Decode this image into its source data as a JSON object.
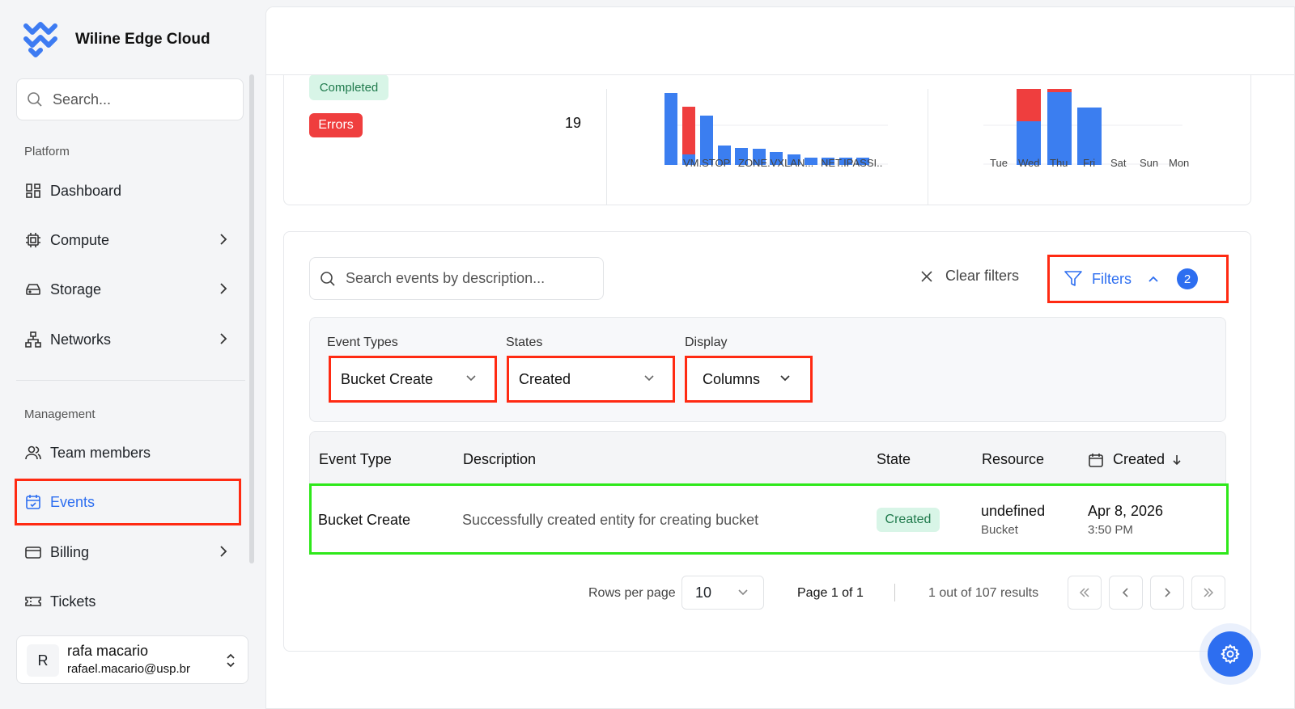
{
  "brand": {
    "name": "Wiline Edge Cloud"
  },
  "sidebar": {
    "search_placeholder": "Search...",
    "platform_label": "Platform",
    "platform_items": [
      {
        "label": "Dashboard",
        "icon": "dashboard-icon"
      },
      {
        "label": "Compute",
        "icon": "cpu-icon"
      },
      {
        "label": "Storage",
        "icon": "storage-icon"
      },
      {
        "label": "Networks",
        "icon": "network-icon"
      }
    ],
    "management_label": "Management",
    "management_items": [
      {
        "label": "Team members",
        "icon": "users-icon"
      },
      {
        "label": "Events",
        "icon": "calendar-check-icon",
        "active": true
      },
      {
        "label": "Billing",
        "icon": "credit-card-icon"
      },
      {
        "label": "Tickets",
        "icon": "ticket-icon"
      }
    ],
    "user": {
      "initial": "R",
      "name": "rafa macario",
      "email": "rafael.macario@usp.br"
    }
  },
  "stats": {
    "completed_label": "Completed",
    "errors_label": "Errors",
    "errors_count": "19",
    "event_type_chart": {
      "tick_labels": [
        "VM.STOP",
        "ZONE.VXLAN...",
        "NET.IPASSI.."
      ]
    },
    "weekday_chart": {
      "categories": [
        "Tue",
        "Wed",
        "Thu",
        "Fri",
        "Sat",
        "Sun",
        "Mon"
      ]
    }
  },
  "events": {
    "search_placeholder": "Search events by description...",
    "clear_filters_label": "Clear filters",
    "filters_label": "Filters",
    "filters_count": "2",
    "filter_panel": {
      "event_types_label": "Event Types",
      "event_types_value": "Bucket Create",
      "states_label": "States",
      "states_value": "Created",
      "display_label": "Display",
      "display_value": "Columns"
    },
    "columns": [
      "Event Type",
      "Description",
      "State",
      "Resource",
      "Created"
    ],
    "rows": [
      {
        "event_type": "Bucket Create",
        "description": "Successfully created entity for creating bucket",
        "state": "Created",
        "resource": "undefined",
        "resource_type": "Bucket",
        "created_date": "Apr 8, 2026",
        "created_time": "3:50 PM"
      }
    ],
    "pagination": {
      "rows_per_page_label": "Rows per page",
      "rows_per_page": "10",
      "page_label": "Page 1 of 1",
      "results_label": "1 out of 107 results"
    }
  },
  "colors": {
    "accent": "#2d6ef0",
    "error": "#ef3e3e",
    "success_bg": "#d8f5e7",
    "highlight_red": "#ff2a12",
    "highlight_green": "#2ee81a"
  }
}
